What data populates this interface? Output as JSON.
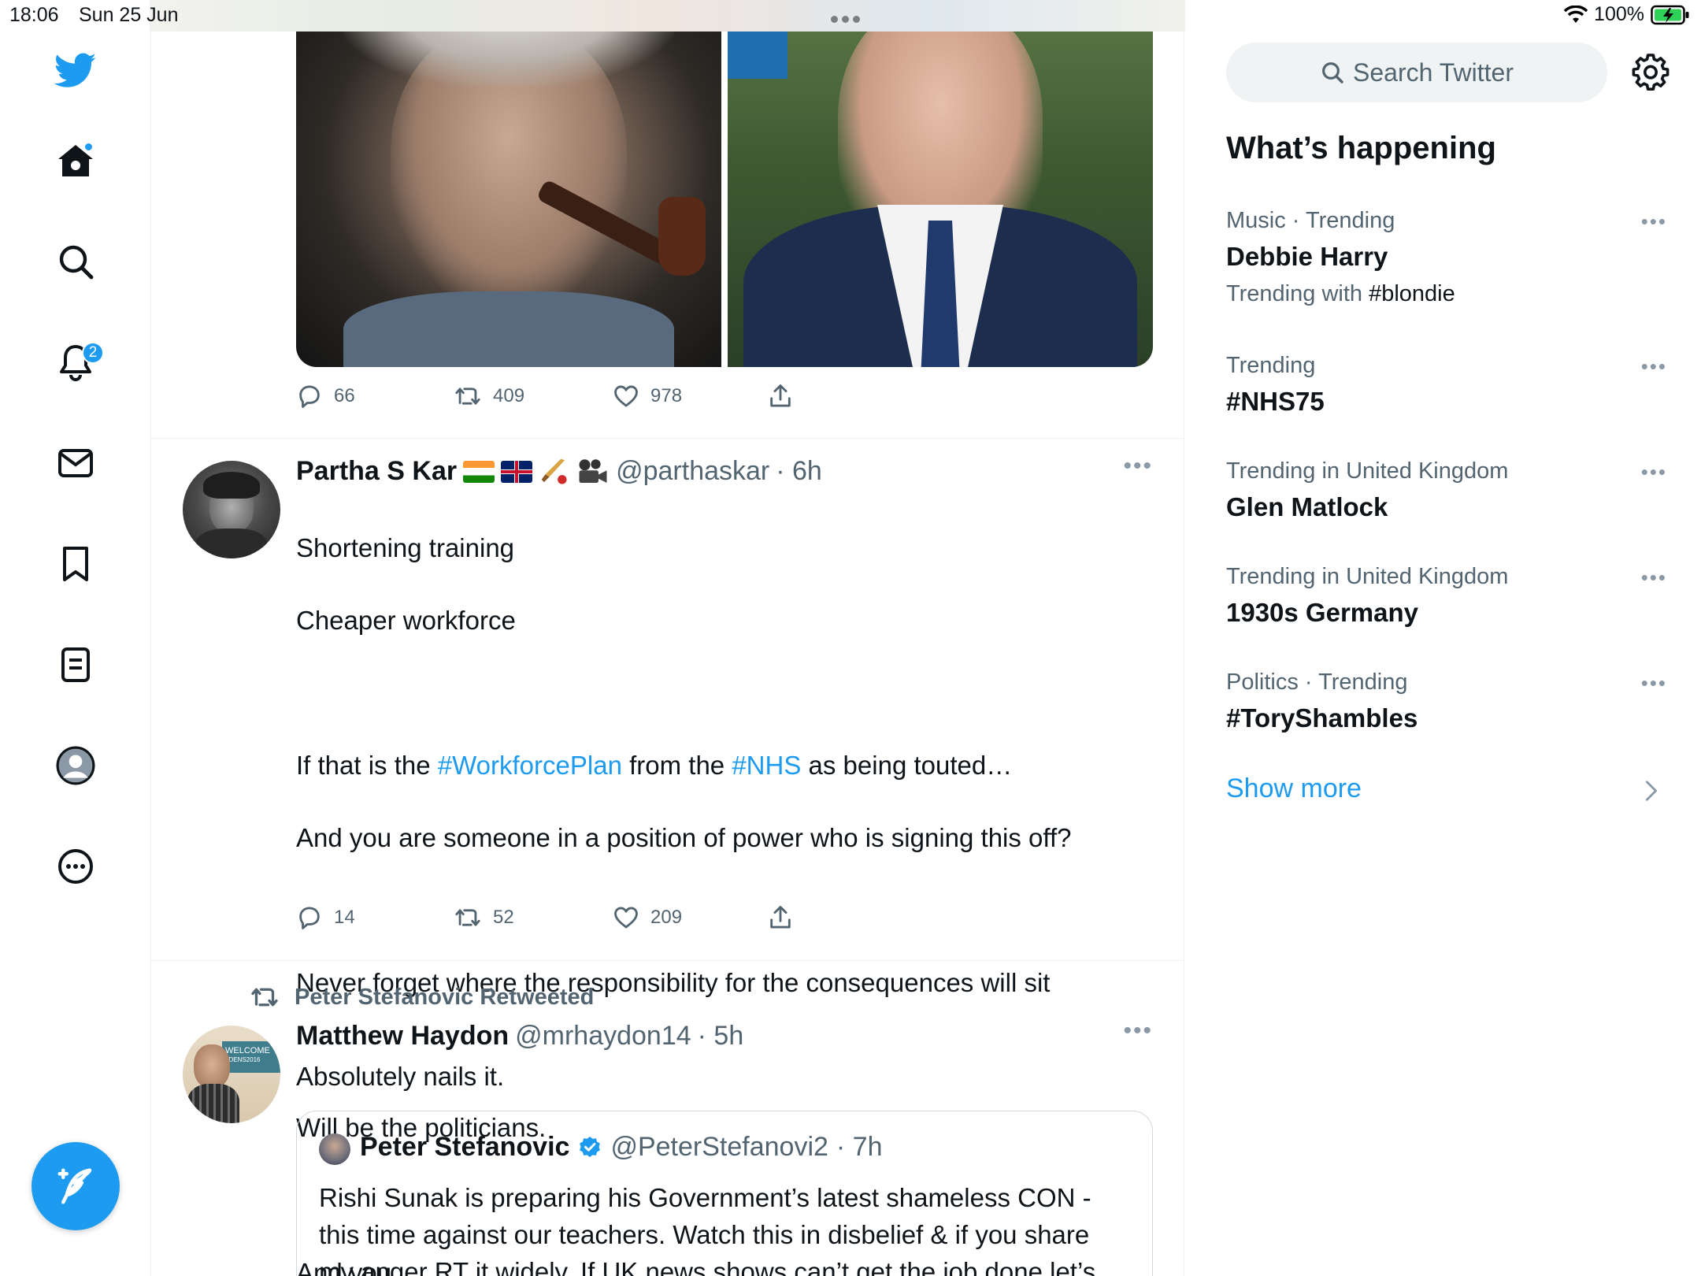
{
  "status_bar": {
    "time": "18:06",
    "date": "Sun 25 Jun",
    "battery": "100%"
  },
  "nav": {
    "notifications_badge": "2",
    "items": [
      "twitter-logo",
      "home-icon",
      "search-icon",
      "bell-icon",
      "mail-icon",
      "bookmark-icon",
      "lists-icon",
      "profile-icon",
      "more-circle-icon"
    ]
  },
  "tweets": [
    {
      "actions": {
        "replies": "66",
        "retweets": "409",
        "likes": "978"
      }
    },
    {
      "name": "Partha S Kar",
      "handle": "@parthaskar",
      "time": "· 6h",
      "lines": {
        "l1": "Shortening training",
        "l2": "Cheaper workforce",
        "l3a": "If that is the ",
        "tag1": "#WorkforcePlan",
        "l3b": " from the ",
        "tag2": "#NHS",
        "l3c": " as being touted…",
        "l4": "And you are someone in a position of power who is signing this off?",
        "l5": "Never forget where the responsibility for the consequences will sit",
        "l6": "Will be the politicians.",
        "l7": "And you."
      },
      "actions": {
        "replies": "14",
        "retweets": "52",
        "likes": "209"
      }
    },
    {
      "retweeted_by": "Peter Stefanovic Retweeted",
      "name": "Matthew Haydon",
      "handle": "@mrhaydon14",
      "time": "· 5h",
      "text": "Absolutely nails it.",
      "avatar_sign": "WELCOME",
      "avatar_sign_sub": "#DENS2016",
      "quote": {
        "name": "Peter Stefanovic",
        "handle": "@PeterStefanovi2",
        "time": "· 7h",
        "line1": "Rishi Sunak is preparing his Government’s latest shameless CON -",
        "line2": "this time against our teachers. Watch this in disbelief & if you share",
        "line3": "my anger RT it widely. If UK news shows can’t get the job done let’s"
      }
    }
  ],
  "right": {
    "search_placeholder": "Search Twitter",
    "title": "What’s happening",
    "trends": [
      {
        "meta": "Music · Trending",
        "name": "Debbie Harry",
        "with_prefix": "Trending with ",
        "with_tag": "#blondie"
      },
      {
        "meta": "Trending",
        "name": "#NHS75"
      },
      {
        "meta": "Trending in United Kingdom",
        "name": "Glen Matlock"
      },
      {
        "meta": "Trending in United Kingdom",
        "name": "1930s Germany"
      },
      {
        "meta": "Politics · Trending",
        "name": "#ToryShambles"
      }
    ],
    "show_more": "Show more"
  },
  "colors": {
    "accent": "#1d9bf0",
    "text": "#0f1419",
    "muted": "#536471",
    "border": "#eff3f4"
  }
}
